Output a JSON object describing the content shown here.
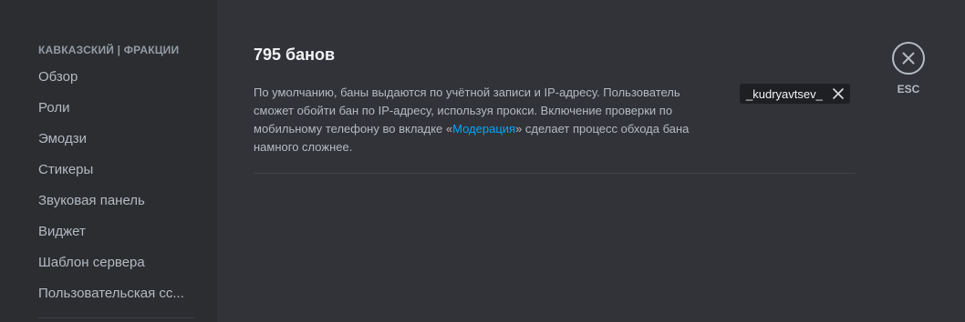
{
  "sidebar": {
    "header": "КАВКАЗСКИЙ | ФРАКЦИИ",
    "items": [
      {
        "label": "Обзор"
      },
      {
        "label": "Роли"
      },
      {
        "label": "Эмодзи"
      },
      {
        "label": "Стикеры"
      },
      {
        "label": "Звуковая панель"
      },
      {
        "label": "Виджет"
      },
      {
        "label": "Шаблон сервера"
      },
      {
        "label": "Пользовательская сс..."
      }
    ]
  },
  "main": {
    "title": "795 банов",
    "description": {
      "before_link": "По умолчанию, баны выдаются по учётной записи и IP-адресу. Пользователь сможет обойти бан по IP-адресу, используя прокси. Включение проверки по мобильному телефону во вкладке «",
      "link": "Модерация",
      "after_link": "» сделает процесс обхода бана намного сложнее."
    },
    "ban_chip": {
      "username": "_kudryavtsev_",
      "remove_icon": "close-icon"
    }
  },
  "close": {
    "icon": "close-circle-icon",
    "label": "ESC"
  },
  "colors": {
    "sidebar_bg": "#2b2d31",
    "main_bg": "#313338",
    "link": "#00a8fc"
  }
}
